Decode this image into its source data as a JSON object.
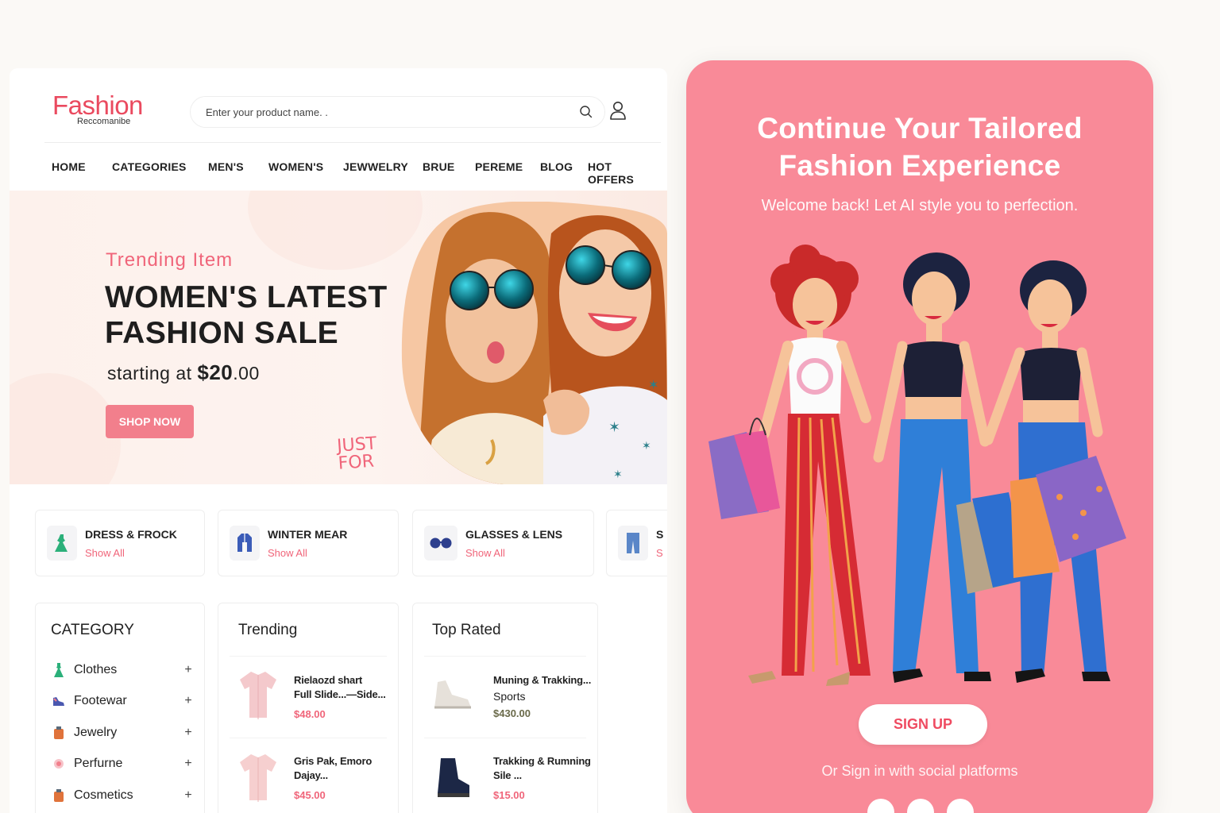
{
  "brand": {
    "name": "Fashion",
    "tagline": "Reccomanibe"
  },
  "search": {
    "placeholder": "Enter your product name. ."
  },
  "nav": [
    "HOME",
    "CATEGORIES",
    "MEN'S",
    "WOMEN'S",
    "JEWWELRY",
    "BRUE",
    "PEREME",
    "BLOG",
    "HOT OFFERS"
  ],
  "hero": {
    "kicker": "Trending Item",
    "title_line1": "WOMEN'S LATEST",
    "title_line2": "FASHION SALE",
    "price_prefix": "starting at",
    "price_main": "$20",
    "price_cents": ".00",
    "cta": "SHOP NOW",
    "doodle_line1": "JUST",
    "doodle_line2": "FOR"
  },
  "category_cards": [
    {
      "title": "DRESS & FROCK",
      "link": "Show All",
      "icon": "dress-icon"
    },
    {
      "title": "WINTER MEAR",
      "link": "Show All",
      "icon": "jacket-icon"
    },
    {
      "title": "GLASSES & LENS",
      "link": "Show All",
      "icon": "glasses-icon"
    },
    {
      "title": "S",
      "link": "S",
      "icon": "jeans-icon"
    }
  ],
  "category_panel": {
    "title": "CATEGORY",
    "items": [
      {
        "label": "Clothes",
        "icon": "dress-icon",
        "action": "+"
      },
      {
        "label": "Footewar",
        "icon": "shoe-icon",
        "action": "+"
      },
      {
        "label": "Jewelry",
        "icon": "jewelry-icon",
        "action": "+"
      },
      {
        "label": "Perfurne",
        "icon": "perfume-icon",
        "action": "+"
      },
      {
        "label": "Cosmetics",
        "icon": "cosmetics-icon",
        "action": "+"
      }
    ]
  },
  "trending": {
    "title": "Trending",
    "items": [
      {
        "name_line1": "Rielaozd shart",
        "name_line2": "Full Slide...—Side...",
        "price": "$48.00"
      },
      {
        "name_line1": "Gris Pak, Emoro",
        "name_line2": "Dajay...",
        "price": "$45.00"
      }
    ]
  },
  "top_rated": {
    "title": "Top Rated",
    "items": [
      {
        "name_line1": "Muning & Trakking...",
        "category": "Sports",
        "price": "$430.00"
      },
      {
        "name_line1": "Trakking & Rumning",
        "name_line2": "Sile ...",
        "price": "$15.00"
      }
    ]
  },
  "signup": {
    "title_line1": "Continue Your Tailored",
    "title_line2": "Fashion Experience",
    "subtitle": "Welcome back! Let AI style you to perfection.",
    "button": "SIGN UP",
    "social_text": "Or Sign in with social platforms"
  },
  "colors": {
    "brand_pink": "#ea4a5f",
    "accent_pink": "#f0657a",
    "card_pink": "#f98a98",
    "button_pink": "#f27f8c"
  }
}
